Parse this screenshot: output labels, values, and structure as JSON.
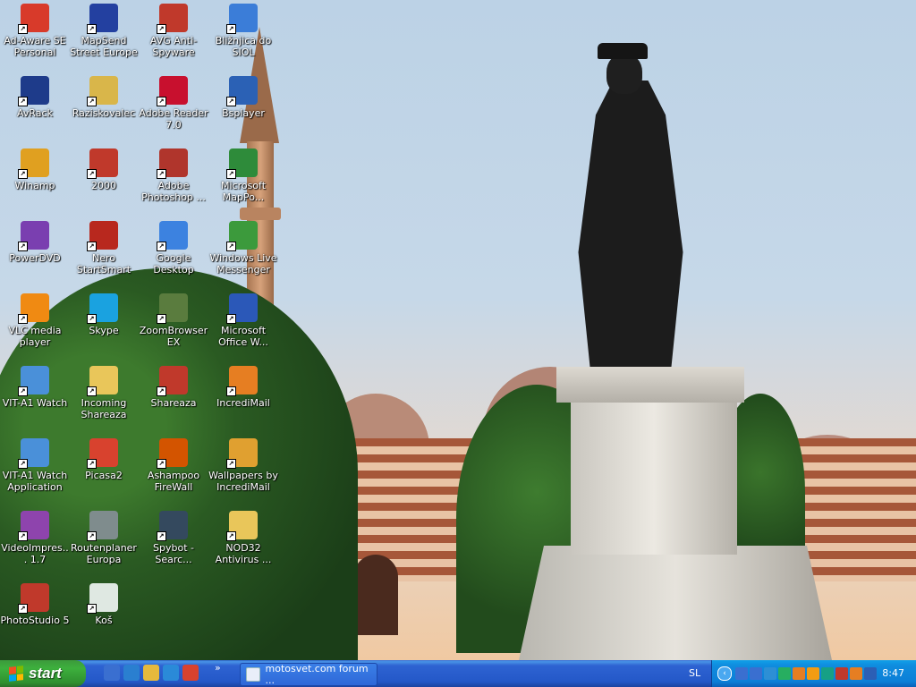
{
  "desktop": {
    "icons": [
      {
        "label": "Ad-Aware SE Personal",
        "icon": "ad-aware-icon",
        "color": "#d83a2a"
      },
      {
        "label": "MapSend Street Europe",
        "icon": "mapsend-icon",
        "color": "#2340a0"
      },
      {
        "label": "AVG Anti-Spyware",
        "icon": "avg-icon",
        "color": "#c0392b"
      },
      {
        "label": "Bližnjica do SIOL",
        "icon": "network-globe-icon",
        "color": "#3b7dd8"
      },
      {
        "label": "AvRack",
        "icon": "avrack-icon",
        "color": "#1e3b8a"
      },
      {
        "label": "Raziskovalec",
        "icon": "explorer-magnifier-icon",
        "color": "#d9b64a"
      },
      {
        "label": "Adobe Reader 7.0",
        "icon": "adobe-reader-icon",
        "color": "#c8102e"
      },
      {
        "label": "Bsplayer",
        "icon": "bsplayer-icon",
        "color": "#2b61b5"
      },
      {
        "label": "Winamp",
        "icon": "winamp-icon",
        "color": "#e0a020"
      },
      {
        "label": "2000",
        "icon": "pim-2000-icon",
        "color": "#c0392b"
      },
      {
        "label": "Adobe Photoshop ...",
        "icon": "photoshop-icon",
        "color": "#b0352c"
      },
      {
        "label": "Microsoft MapPo...",
        "icon": "mappoint-icon",
        "color": "#2e8b3a"
      },
      {
        "label": "PowerDVD",
        "icon": "powerdvd-icon",
        "color": "#7a3fb0"
      },
      {
        "label": "Nero StartSmart",
        "icon": "nero-icon",
        "color": "#b8281e"
      },
      {
        "label": "Google Desktop",
        "icon": "google-desktop-icon",
        "color": "#3c82e0"
      },
      {
        "label": "Windows Live Messenger",
        "icon": "messenger-icon",
        "color": "#3c9a3c"
      },
      {
        "label": "VLC media player",
        "icon": "vlc-cone-icon",
        "color": "#f08a12"
      },
      {
        "label": "Skype",
        "icon": "skype-icon",
        "color": "#1aa2e0"
      },
      {
        "label": "ZoomBrowser EX",
        "icon": "zoombrowser-icon",
        "color": "#5a7c3e"
      },
      {
        "label": "Microsoft Office W...",
        "icon": "word-icon",
        "color": "#2b58b8"
      },
      {
        "label": "VIT-A1 Watch",
        "icon": "vit-watch-icon",
        "color": "#4a90d9"
      },
      {
        "label": "Incoming Shareaza",
        "icon": "folder-icon",
        "color": "#e9c65a"
      },
      {
        "label": "Shareaza",
        "icon": "shareaza-icon",
        "color": "#c0392b"
      },
      {
        "label": "IncrediMail",
        "icon": "incredimail-icon",
        "color": "#e67e22"
      },
      {
        "label": "VIT-A1 Watch Application",
        "icon": "vit-app-icon",
        "color": "#4a90d9"
      },
      {
        "label": "Picasa2",
        "icon": "picasa-icon",
        "color": "#d8422e"
      },
      {
        "label": "Ashampoo FireWall",
        "icon": "firewall-icon",
        "color": "#d35400"
      },
      {
        "label": "Wallpapers by IncrediMail",
        "icon": "butterfly-icon",
        "color": "#e0a030"
      },
      {
        "label": "VideoImpres... 1.7",
        "icon": "videoimpression-icon",
        "color": "#8e44ad"
      },
      {
        "label": "Routenplaner Europa",
        "icon": "routenplaner-icon",
        "color": "#7f8c8d"
      },
      {
        "label": "Spybot - Searc...",
        "icon": "spybot-icon",
        "color": "#34495e"
      },
      {
        "label": "NOD32 Antivirus ...",
        "icon": "folder-icon",
        "color": "#e9c65a"
      },
      {
        "label": "PhotoStudio 5",
        "icon": "photostudio-icon",
        "color": "#c0392b"
      },
      {
        "label": "Koš",
        "icon": "recycle-bin-icon",
        "color": "#dfe8e2"
      }
    ]
  },
  "taskbar": {
    "start_label": "start",
    "quick_launch": [
      {
        "icon": "settings-icon",
        "color": "#3a6fd0"
      },
      {
        "icon": "media-player-icon",
        "color": "#2a7fd0"
      },
      {
        "icon": "folder-icon",
        "color": "#e6b93c"
      },
      {
        "icon": "internet-explorer-icon",
        "color": "#2a8ad8"
      },
      {
        "icon": "mail-icon",
        "color": "#d8422e"
      }
    ],
    "quick_launch_more": "»",
    "window_button": "motosvet.com forum ...",
    "language": "SL",
    "tray_icons": [
      {
        "icon": "network-icon",
        "color": "#3a6fd0"
      },
      {
        "icon": "network-icon",
        "color": "#3a6fd0"
      },
      {
        "icon": "sync-icon",
        "color": "#2d8fd5"
      },
      {
        "icon": "download-icon",
        "color": "#27ae60"
      },
      {
        "icon": "monitor-icon",
        "color": "#e67e22"
      },
      {
        "icon": "shield-icon",
        "color": "#f39c12"
      },
      {
        "icon": "antivirus-icon",
        "color": "#16a085"
      },
      {
        "icon": "circle-icon",
        "color": "#c0392b"
      },
      {
        "icon": "m-icon",
        "color": "#e67e22"
      },
      {
        "icon": "mail-icon",
        "color": "#2c5fb5"
      }
    ],
    "clock": "8:47"
  }
}
